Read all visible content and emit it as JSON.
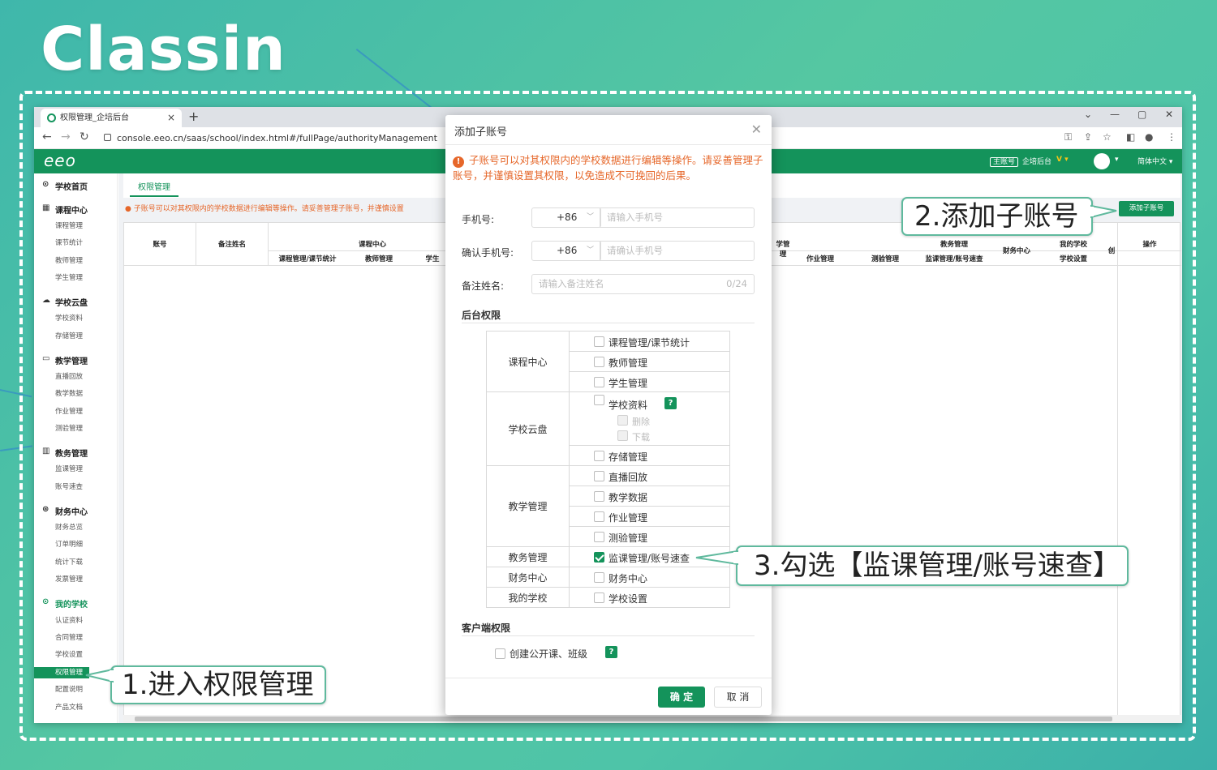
{
  "brand": {
    "logo_text": "Classin"
  },
  "browser": {
    "tab_title": "权限管理_企培后台",
    "tab_close": "×",
    "new_tab": "+",
    "url": "console.eeo.cn/saas/school/index.html#/fullPage/authorityManagement",
    "window_controls": [
      "⌄",
      "—",
      "▢",
      "✕"
    ]
  },
  "appbar": {
    "logo": "eeo",
    "role_badge": "主账号",
    "backend": "企培后台",
    "language": "简体中文"
  },
  "sidebar": {
    "sections": [
      {
        "title": "学校首页",
        "icon": "home-icon",
        "items": []
      },
      {
        "title": "课程中心",
        "icon": "calendar-icon",
        "items": [
          "课程管理",
          "课节统计",
          "教师管理",
          "学生管理"
        ]
      },
      {
        "title": "学校云盘",
        "icon": "cloud-icon",
        "items": [
          "学校资料",
          "存储管理"
        ]
      },
      {
        "title": "教学管理",
        "icon": "monitor-icon",
        "items": [
          "直播回放",
          "教学数据",
          "作业管理",
          "测验管理"
        ]
      },
      {
        "title": "教务管理",
        "icon": "grid-icon",
        "items": [
          "监课管理",
          "账号速查"
        ]
      },
      {
        "title": "财务中心",
        "icon": "money-icon",
        "items": [
          "财务总览",
          "订单明细",
          "统计下载",
          "发票管理"
        ]
      },
      {
        "title": "我的学校",
        "icon": "school-icon",
        "items": [
          "认证资料",
          "合同管理",
          "学校设置",
          "权限管理",
          "配置说明",
          "产品文档"
        ]
      }
    ],
    "active_item": "权限管理"
  },
  "page": {
    "tab_label": "权限管理",
    "warning": "子账号可以对其权限内的学校数据进行编辑等操作。请妥善管理子账号，并谨慎设置",
    "add_button": "添加子账号",
    "table_headers": {
      "account": "账号",
      "remark": "备注姓名",
      "course_center": "课程中心",
      "course_mgmt": "课程管理/课节统计",
      "teacher_mgmt": "教师管理",
      "student_mgmt": "学生",
      "teaching_mgmt": "学管理",
      "homework": "作业管理",
      "quiz": "测验管理",
      "edu_affairs": "教务管理",
      "supervise": "监课管理/账号速查",
      "finance": "财务中心",
      "my_school": "我的学校",
      "school_settings": "学校设置",
      "created": "创",
      "actions": "操作"
    }
  },
  "modal": {
    "title": "添加子账号",
    "warning_icon": "!",
    "warning": "子账号可以对其权限内的学校数据进行编辑等操作。请妥善管理子账号，并谨慎设置其权限，以免造成不可挽回的后果。",
    "phone_label": "手机号:",
    "phone_prefix": "+86",
    "phone_placeholder": "请输入手机号",
    "confirm_label": "确认手机号:",
    "confirm_prefix": "+86",
    "confirm_placeholder": "请确认手机号",
    "remark_label": "备注姓名:",
    "remark_placeholder": "请输入备注姓名",
    "remark_count": "0/24",
    "backend_section": "后台权限",
    "client_section": "客户端权限",
    "client_option": "创建公开课、班级",
    "help": "?",
    "ok": "确 定",
    "cancel": "取 消",
    "permissions": {
      "course_center": {
        "label": "课程中心",
        "items": [
          {
            "label": "课程管理/课节统计",
            "checked": false
          },
          {
            "label": "教师管理",
            "checked": false
          },
          {
            "label": "学生管理",
            "checked": false
          }
        ]
      },
      "school_cloud": {
        "label": "学校云盘",
        "items": [
          {
            "label": "学校资料",
            "checked": false
          },
          {
            "label": "删除",
            "checked": false
          },
          {
            "label": "下载",
            "checked": false
          },
          {
            "label": "存储管理",
            "checked": false
          }
        ]
      },
      "teaching": {
        "label": "教学管理",
        "items": [
          {
            "label": "直播回放",
            "checked": false
          },
          {
            "label": "教学数据",
            "checked": false
          },
          {
            "label": "作业管理",
            "checked": false
          },
          {
            "label": "测验管理",
            "checked": false
          }
        ]
      },
      "affairs": {
        "label": "教务管理",
        "items": [
          {
            "label": "监课管理/账号速查",
            "checked": true
          }
        ]
      },
      "finance": {
        "label": "财务中心",
        "items": [
          {
            "label": "财务中心",
            "checked": false
          }
        ]
      },
      "school": {
        "label": "我的学校",
        "items": [
          {
            "label": "学校设置",
            "checked": false
          }
        ]
      }
    }
  },
  "callouts": {
    "step1": "1.进入权限管理",
    "step2": "2.添加子账号",
    "step3": "3.勾选【监课管理/账号速查】"
  },
  "colors": {
    "brand_green": "#14935b",
    "warning_orange": "#e6672a",
    "callout_border": "#5fb99d"
  }
}
